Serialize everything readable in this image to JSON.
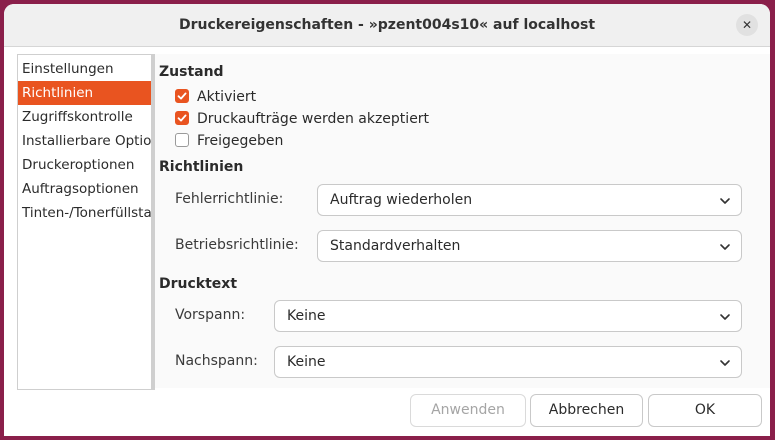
{
  "window": {
    "title": "Druckereigenschaften - »pzent004s10« auf localhost",
    "close_glyph": "✕"
  },
  "sidebar": {
    "items": [
      {
        "label": "Einstellungen",
        "selected": false
      },
      {
        "label": "Richtlinien",
        "selected": true
      },
      {
        "label": "Zugriffskontrolle",
        "selected": false
      },
      {
        "label": "Installierbare Optionen",
        "selected": false
      },
      {
        "label": "Druckeroptionen",
        "selected": false
      },
      {
        "label": "Auftragsoptionen",
        "selected": false
      },
      {
        "label": "Tinten-/Tonerfüllstand",
        "selected": false
      }
    ]
  },
  "zustand": {
    "heading": "Zustand",
    "checks": [
      {
        "label": "Aktiviert",
        "checked": true
      },
      {
        "label": "Druckaufträge werden akzeptiert",
        "checked": true
      },
      {
        "label": "Freigegeben",
        "checked": false
      }
    ]
  },
  "richtlinien": {
    "heading": "Richtlinien",
    "error_policy": {
      "label": "Fehlerrichtlinie:",
      "value": "Auftrag wiederholen"
    },
    "operation_policy": {
      "label": "Betriebsrichtlinie:",
      "value": "Standardverhalten"
    }
  },
  "drucktext": {
    "heading": "Drucktext",
    "vorspann": {
      "label": "Vorspann:",
      "value": "Keine"
    },
    "nachspann": {
      "label": "Nachspann:",
      "value": "Keine"
    }
  },
  "buttons": {
    "apply": "Anwenden",
    "cancel": "Abbrechen",
    "ok": "OK"
  },
  "colors": {
    "accent": "#e95420",
    "desktop": "#8a1f4a"
  }
}
